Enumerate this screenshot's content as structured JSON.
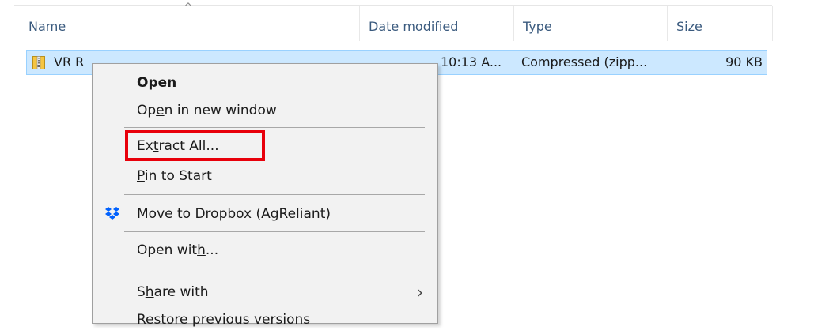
{
  "columns": {
    "name": "Name",
    "date_modified": "Date modified",
    "type": "Type",
    "size": "Size",
    "sort_indicator": "^"
  },
  "file": {
    "name_visible": "VR R",
    "date_modified": "10:13 A...",
    "type": "Compressed (zipp...",
    "size": "90 KB",
    "icon": "zip-folder-icon"
  },
  "context_menu": {
    "items": [
      {
        "pre": "",
        "mn": "O",
        "post": "pen",
        "bold": true
      },
      {
        "pre": "Op",
        "mn": "e",
        "post": "n in new window"
      },
      {
        "pre": "Ex",
        "mn": "t",
        "post": "ract All..."
      },
      {
        "pre": "",
        "mn": "P",
        "post": "in to Start"
      },
      {
        "pre": "Move to Dropbox (AgReliant)",
        "mn": "",
        "post": "",
        "icon": "dropbox-icon"
      },
      {
        "pre": "Open wit",
        "mn": "h",
        "post": "..."
      },
      {
        "pre": "S",
        "mn": "h",
        "post": "are with",
        "submenu": true
      },
      {
        "pre": "Restore previous versions",
        "mn": "",
        "post": ""
      }
    ],
    "highlighted_item": "Extract All..."
  },
  "colors": {
    "selection_bg": "#cce8ff",
    "selection_border": "#99d1ff",
    "highlight_box": "#e8000b",
    "menu_bg": "#f2f2f2"
  }
}
